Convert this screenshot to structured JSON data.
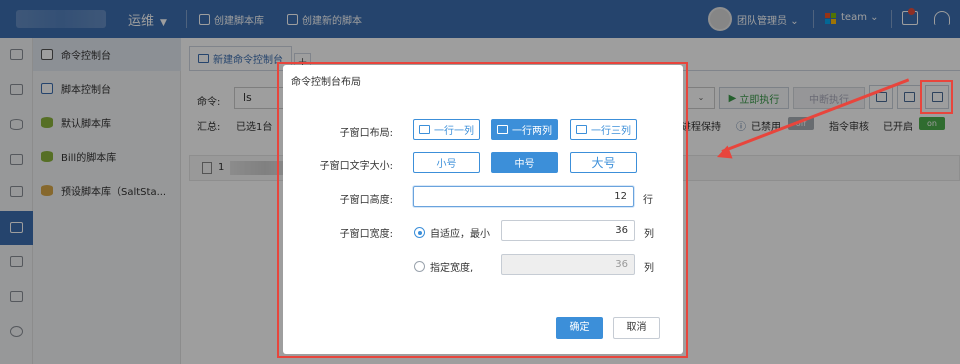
{
  "topbar": {
    "app_title": "运维",
    "link_create_lib": "创建脚本库",
    "link_create_script": "创建新的脚本",
    "user_name": "团队管理员",
    "team_name": "team"
  },
  "sidebar": {
    "items": [
      {
        "label": "命令控制台",
        "icon": "terminal-icon",
        "active": true
      },
      {
        "label": "脚本控制台",
        "icon": "code-icon",
        "active": false
      },
      {
        "label": "默认脚本库",
        "icon": "database-icon",
        "active": false
      },
      {
        "label": "Bill的脚本库",
        "icon": "database-icon",
        "active": false
      },
      {
        "label": "预设脚本库（SaltSta...",
        "icon": "database-icon",
        "active": false
      }
    ]
  },
  "main": {
    "tab_label": "新建命令控制台",
    "tab_add": "+",
    "cmd_label": "命令:",
    "cmd_value": "ls",
    "summary_label": "汇总:",
    "summary_value": "已选1台",
    "run_label": "立即执行",
    "stop_label": "中断执行",
    "keep_label": "进程保持",
    "disabled_label": "已禁用",
    "toggle_off": "off",
    "audit_label": "指令审核",
    "enabled_label": "已开启",
    "toggle_on": "on",
    "panel_index": "1"
  },
  "modal": {
    "title": "命令控制台布局",
    "layout_label": "子窗口布局:",
    "layout_options": [
      "一行一列",
      "一行两列",
      "一行三列"
    ],
    "layout_selected": 1,
    "font_label": "子窗口文字大小:",
    "font_options": [
      "小号",
      "中号",
      "大号"
    ],
    "font_selected": 1,
    "height_label": "子窗口高度:",
    "height_value": "12",
    "height_unit": "行",
    "width_label": "子窗口宽度:",
    "auto_label": "自适应，最小",
    "auto_value": "36",
    "auto_unit": "列",
    "fixed_label": "指定宽度,",
    "fixed_value": "36",
    "fixed_unit": "列",
    "ok_label": "确定",
    "cancel_label": "取消"
  },
  "colors": {
    "brand": "#3c6fb0",
    "accent": "#3c8fd9",
    "highlight": "#e8453c"
  }
}
